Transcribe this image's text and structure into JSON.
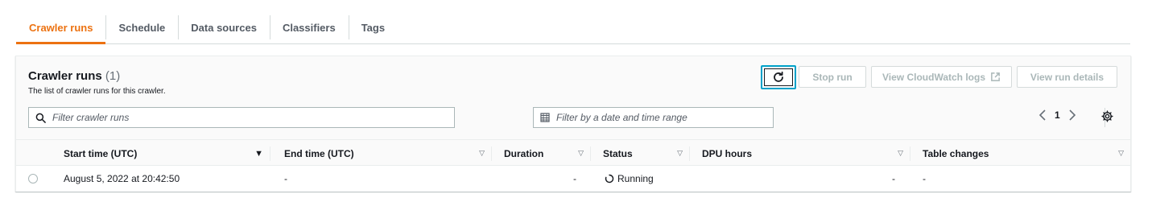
{
  "tabs": [
    {
      "label": "Crawler runs",
      "active": true
    },
    {
      "label": "Schedule",
      "active": false
    },
    {
      "label": "Data sources",
      "active": false
    },
    {
      "label": "Classifiers",
      "active": false
    },
    {
      "label": "Tags",
      "active": false
    }
  ],
  "panel": {
    "title": "Crawler runs",
    "count": "(1)",
    "description": "The list of crawler runs for this crawler."
  },
  "actions": {
    "refresh_icon": "refresh-icon",
    "stop_run": "Stop run",
    "view_cloudwatch_logs": "View CloudWatch logs",
    "external_icon": "external-link-icon",
    "view_run_details": "View run details"
  },
  "filters": {
    "search_placeholder": "Filter crawler runs",
    "date_placeholder": "Filter by a date and time range"
  },
  "pagination": {
    "current_page": "1"
  },
  "table": {
    "columns": [
      "Start time (UTC)",
      "End time (UTC)",
      "Duration",
      "Status",
      "DPU hours",
      "Table changes"
    ],
    "rows": [
      {
        "start_time": "August 5, 2022 at 20:42:50",
        "end_time": "-",
        "duration": "-",
        "status": "Running",
        "dpu_hours": "-",
        "table_changes": "-"
      }
    ]
  },
  "colors": {
    "accent": "#ec7211",
    "focus": "#00a1c9",
    "disabled_text": "#aab7b8"
  }
}
